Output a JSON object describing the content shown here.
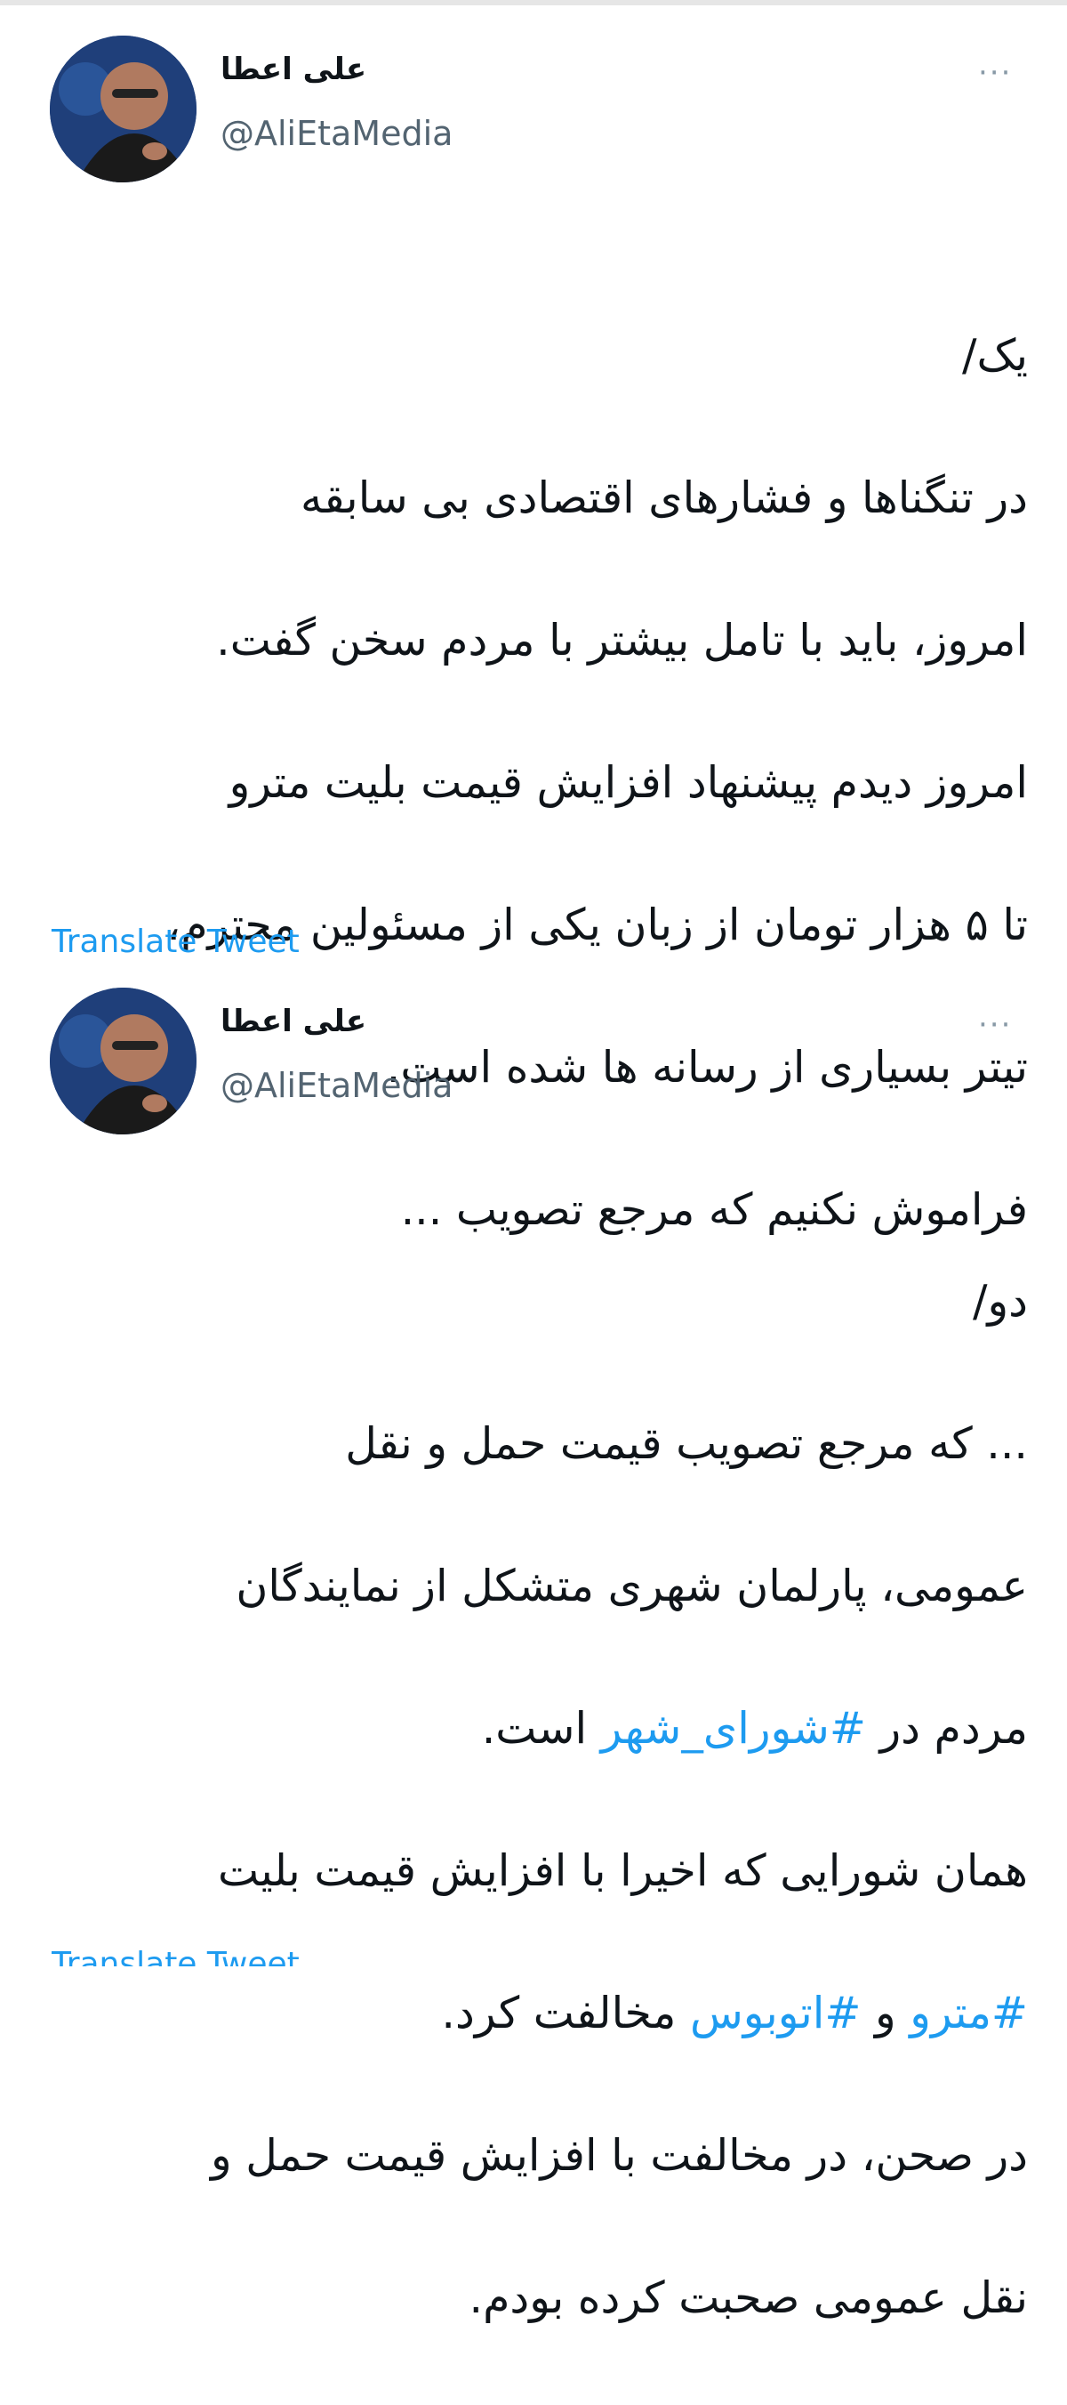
{
  "tweets": [
    {
      "author_name": "علی اعطا",
      "handle": "@AliEtaMedia",
      "more_label": "···",
      "lines": [
        "یک/",
        "در تنگناها و فشارهای اقتصادی بی سابقه",
        "امروز، باید با تامل بیشتر با مردم سخن گفت.",
        "امروز دیدم پیشنهاد افزایش قیمت بلیت مترو",
        "تا ۵ هزار تومان از زبان یکی از مسئولین محترم،",
        "تیتر بسیاری از رسانه ها شده است.",
        "فراموش نکنیم که مرجع تصویب ..."
      ],
      "translate_label": "Translate Tweet"
    },
    {
      "author_name": "علی اعطا",
      "handle": "@AliEtaMedia",
      "more_label": "···",
      "intro": "دو/",
      "line1": "... که مرجع تصویب قیمت حمل و نقل",
      "line2": "عمومی، پارلمان شهری متشکل از نمایندگان",
      "line3_pre": "مردم در ",
      "hashtag_council": "#شورای_شهر",
      "line3_post": " است.",
      "line4": "همان شورایی که اخیرا با افزایش قیمت بلیت",
      "hashtag_metro": "#مترو",
      "line5_mid": " و ",
      "hashtag_bus": "#اتوبوس",
      "line5_post": " مخالفت کرد.",
      "line6": "در صحن، در مخالفت با افزایش قیمت حمل و",
      "line7": "نقل عمومی صحبت کرده بودم.",
      "translate_label": "Translate Tweet"
    }
  ],
  "colors": {
    "link": "#1d9bf0",
    "secondary_text": "#536471",
    "avatar_bg": "#1f3f7a"
  }
}
